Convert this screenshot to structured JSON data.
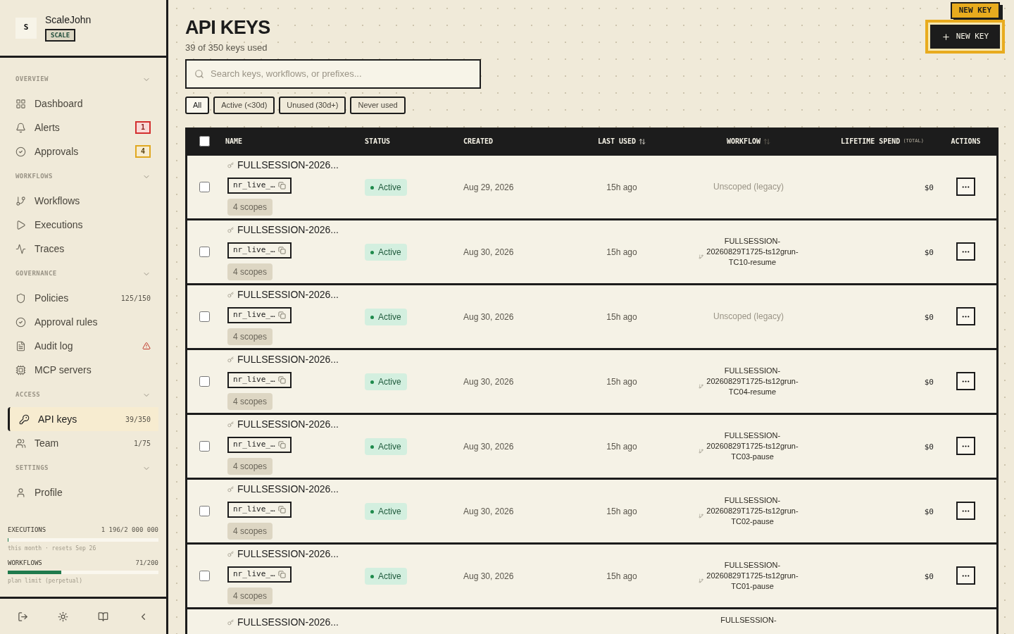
{
  "sidebar": {
    "user": {
      "initial": "S",
      "name": "ScaleJohn",
      "plan": "SCALE"
    },
    "sections": [
      {
        "title": "OVERVIEW",
        "items": [
          {
            "label": "Dashboard",
            "selected": false
          },
          {
            "label": "Alerts",
            "selected": false,
            "badge": {
              "text": "1",
              "kind": "danger"
            }
          },
          {
            "label": "Approvals",
            "selected": false,
            "badge": {
              "text": "4",
              "kind": "warning"
            }
          }
        ]
      },
      {
        "title": "WORKFLOWS",
        "items": [
          {
            "label": "Workflows",
            "selected": false
          },
          {
            "label": "Executions",
            "selected": false
          },
          {
            "label": "Traces",
            "selected": false
          }
        ]
      },
      {
        "title": "GOVERNANCE",
        "items": [
          {
            "label": "Policies",
            "selected": false,
            "count": "125/150"
          },
          {
            "label": "Approval rules",
            "selected": false
          },
          {
            "label": "Audit log",
            "selected": false,
            "warning": true
          },
          {
            "label": "MCP servers",
            "selected": false
          }
        ]
      },
      {
        "title": "ACCESS",
        "items": [
          {
            "label": "API keys",
            "selected": true,
            "count": "39/350"
          },
          {
            "label": "Team",
            "selected": false,
            "count": "1/75"
          }
        ]
      },
      {
        "title": "SETTINGS",
        "items": [
          {
            "label": "Profile",
            "selected": false
          }
        ]
      }
    ],
    "meters": [
      {
        "label": "EXECUTIONS",
        "reading": "1 196/2 000 000",
        "level": 0.005,
        "note": "this month · resets Sep 26"
      },
      {
        "label": "WORKFLOWS",
        "reading": "71/200",
        "level": 0.355,
        "note": "plan limit (perpetual)"
      }
    ]
  },
  "main": {
    "title": "API KEYS",
    "subtitle": "39 of 350 keys used",
    "new_key_tag": "NEW KEY",
    "new_key_button": "NEW KEY",
    "search": {
      "placeholder": "Search keys, workflows, or prefixes..."
    },
    "filters": [
      {
        "label": "All",
        "selected": true
      },
      {
        "label": "Active (<30d)",
        "selected": false
      },
      {
        "label": "Unused (30d+)",
        "selected": false
      },
      {
        "label": "Never used",
        "selected": false
      }
    ],
    "table": {
      "select_all": {
        "checked": false
      },
      "columns": [
        {
          "label": "NAME"
        },
        {
          "label": "STATUS"
        },
        {
          "label": "CREATED"
        },
        {
          "label": "LAST USED",
          "sortable": true,
          "sorted": true
        },
        {
          "label": "WORKFLOW",
          "sortable": true,
          "sorted": false
        },
        {
          "label": "LIFETIME SPEND",
          "note": "(TOTAL)"
        },
        {
          "label": "ACTIONS"
        }
      ],
      "rows": [
        {
          "checked": false,
          "name": "FULLSESSION-2026...",
          "prefix": "nr_live_…",
          "scopes": "4 scopes",
          "status": "Active",
          "created": "Aug 29, 2026",
          "last_used": "15h ago",
          "workflow": {
            "kind": "legacy",
            "lines": [
              "Unscoped (legacy)"
            ]
          },
          "spend": "$0"
        },
        {
          "checked": false,
          "name": "FULLSESSION-2026...",
          "prefix": "nr_live_…",
          "scopes": "4 scopes",
          "status": "Active",
          "created": "Aug 30, 2026",
          "last_used": "15h ago",
          "workflow": {
            "kind": "linked",
            "lines": [
              "FULLSESSION-",
              "20260829T1725-ts12grun-",
              "TC10-resume"
            ]
          },
          "spend": "$0"
        },
        {
          "checked": false,
          "name": "FULLSESSION-2026...",
          "prefix": "nr_live_…",
          "scopes": "4 scopes",
          "status": "Active",
          "created": "Aug 30, 2026",
          "last_used": "15h ago",
          "workflow": {
            "kind": "legacy",
            "lines": [
              "Unscoped (legacy)"
            ]
          },
          "spend": "$0"
        },
        {
          "checked": false,
          "name": "FULLSESSION-2026...",
          "prefix": "nr_live_…",
          "scopes": "4 scopes",
          "status": "Active",
          "created": "Aug 30, 2026",
          "last_used": "15h ago",
          "workflow": {
            "kind": "linked",
            "lines": [
              "FULLSESSION-",
              "20260829T1725-ts12grun-",
              "TC04-resume"
            ]
          },
          "spend": "$0"
        },
        {
          "checked": false,
          "name": "FULLSESSION-2026...",
          "prefix": "nr_live_…",
          "scopes": "4 scopes",
          "status": "Active",
          "created": "Aug 30, 2026",
          "last_used": "15h ago",
          "workflow": {
            "kind": "linked",
            "lines": [
              "FULLSESSION-",
              "20260829T1725-ts12grun-",
              "TC03-pause"
            ]
          },
          "spend": "$0"
        },
        {
          "checked": false,
          "name": "FULLSESSION-2026...",
          "prefix": "nr_live_…",
          "scopes": "4 scopes",
          "status": "Active",
          "created": "Aug 30, 2026",
          "last_used": "15h ago",
          "workflow": {
            "kind": "linked",
            "lines": [
              "FULLSESSION-",
              "20260829T1725-ts12grun-",
              "TC02-pause"
            ]
          },
          "spend": "$0"
        },
        {
          "checked": false,
          "name": "FULLSESSION-2026...",
          "prefix": "nr_live_…",
          "scopes": "4 scopes",
          "status": "Active",
          "created": "Aug 30, 2026",
          "last_used": "15h ago",
          "workflow": {
            "kind": "linked",
            "lines": [
              "FULLSESSION-",
              "20260829T1725-ts12grun-",
              "TC01-pause"
            ]
          },
          "spend": "$0"
        },
        {
          "name": "FULLSESSION-2026...",
          "workflow": {
            "kind": "cut",
            "lines": [
              "FULLSESSION-"
            ]
          }
        }
      ]
    }
  }
}
